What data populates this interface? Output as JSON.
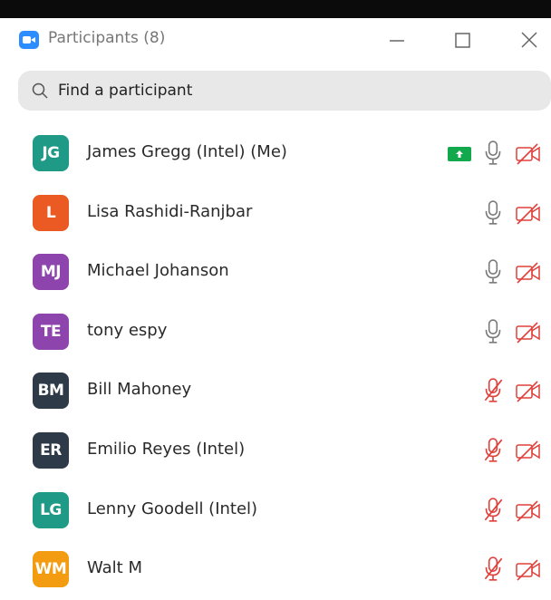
{
  "window": {
    "title": "Participants (8)",
    "icons": {
      "app": "zoom-app-icon",
      "minimize": "minimize-icon",
      "maximize": "maximize-icon",
      "close": "close-icon"
    }
  },
  "search": {
    "placeholder": "Find a participant",
    "value": "",
    "icon": "search-icon"
  },
  "colors": {
    "mic_on": "#7a7a7a",
    "muted": "#e0403a",
    "share": "#12a84c"
  },
  "participants": [
    {
      "initials": "JG",
      "name": "James Gregg (Intel) (Me)",
      "avatar_color": "#1e9a86",
      "sharing": true,
      "muted": false,
      "video_off": true
    },
    {
      "initials": "L",
      "name": "Lisa Rashidi-Ranjbar",
      "avatar_color": "#ea5a22",
      "sharing": false,
      "muted": false,
      "video_off": true
    },
    {
      "initials": "MJ",
      "name": "Michael Johanson",
      "avatar_color": "#8e44ad",
      "sharing": false,
      "muted": false,
      "video_off": true
    },
    {
      "initials": "TE",
      "name": "tony espy",
      "avatar_color": "#8e44ad",
      "sharing": false,
      "muted": false,
      "video_off": true
    },
    {
      "initials": "BM",
      "name": "Bill Mahoney",
      "avatar_color": "#2e3a47",
      "sharing": false,
      "muted": true,
      "video_off": true
    },
    {
      "initials": "ER",
      "name": "Emilio Reyes (Intel)",
      "avatar_color": "#2e3a47",
      "sharing": false,
      "muted": true,
      "video_off": true
    },
    {
      "initials": "LG",
      "name": "Lenny Goodell (Intel)",
      "avatar_color": "#1e9a86",
      "sharing": false,
      "muted": true,
      "video_off": true
    },
    {
      "initials": "WM",
      "name": "Walt M",
      "avatar_color": "#f39c12",
      "sharing": false,
      "muted": true,
      "video_off": true
    }
  ]
}
